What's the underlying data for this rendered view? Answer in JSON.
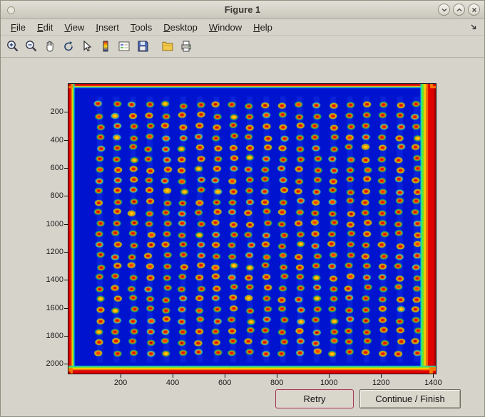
{
  "window": {
    "title": "Figure 1"
  },
  "menus": [
    "File",
    "Edit",
    "View",
    "Insert",
    "Tools",
    "Desktop",
    "Window",
    "Help"
  ],
  "titlebar": {
    "icons": [
      "window-menu-icon",
      "shade-icon",
      "unshade-icon",
      "close-icon"
    ]
  },
  "menubar_right_icon": "dock-figure-icon",
  "toolbar": {
    "icons": [
      "zoom-in",
      "zoom-out",
      "pan-hand",
      "rotate-3d",
      "data-cursor",
      "insert-colorbar",
      "insert-legend",
      "save-figure",
      "open-file",
      "print-figure"
    ]
  },
  "buttons": {
    "retry": "Retry",
    "continue": "Continue / Finish"
  },
  "chart_data": {
    "type": "heatmap",
    "title": "",
    "description": "False-color (jet colormap) scanned plate / microarray image: deep blue field with a regular grid of spots having red-orange centers and green-yellow halos; image borders saturate to red/orange/yellow, with a yellow-green vertical stripe just inside the right red edge.",
    "xlim": [
      0,
      1410
    ],
    "ylim": [
      0,
      2070
    ],
    "x_ticks": [
      200,
      400,
      600,
      800,
      1000,
      1200,
      1400
    ],
    "y_ticks": [
      200,
      400,
      600,
      800,
      1000,
      1200,
      1400,
      1600,
      1800,
      2000
    ],
    "grid": {
      "rows": 24,
      "cols": 20,
      "x_start": 120,
      "x_spacing": 64,
      "y_start": 150,
      "y_spacing": 77
    },
    "colors": {
      "background": "#0013cf",
      "spot_center": "#da1400",
      "spot_mid": "#ff7a00",
      "halo_green": "#17c94a",
      "halo_yellow": "#b8e000",
      "edge_red": "#e00000",
      "edge_orange": "#ff6a00",
      "edge_yellow": "#ffd300",
      "edge_green": "#62e82a",
      "edge_cyan": "#00d8e8"
    }
  }
}
